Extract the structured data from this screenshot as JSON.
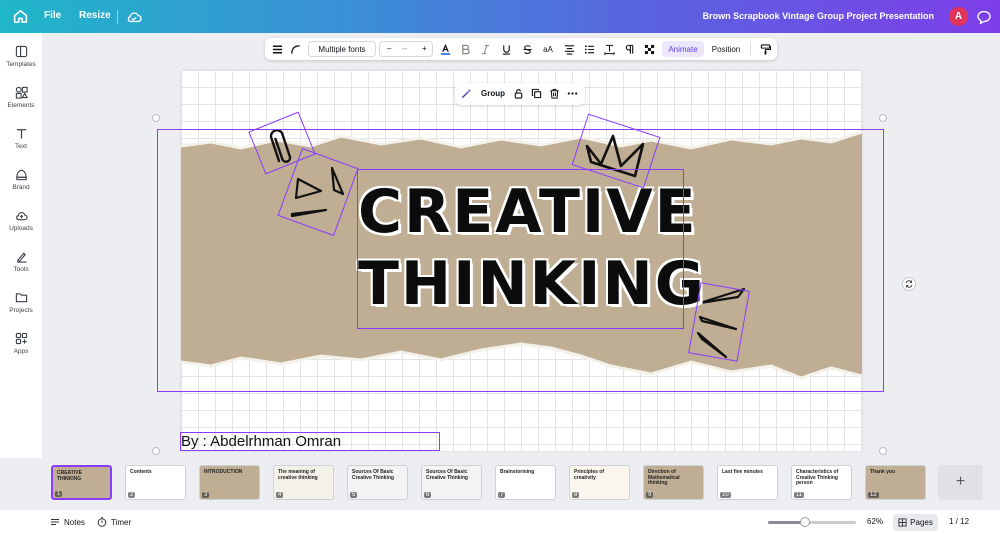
{
  "topbar": {
    "file_label": "File",
    "resize_label": "Resize",
    "document_title": "Brown Scrapbook Vintage Group Project Presentation",
    "avatar_initial": "A",
    "colors": {
      "gradient_start": "#1fb6c9",
      "gradient_end": "#7d3ee8",
      "avatar": "#e0345b"
    }
  },
  "sidebar": {
    "items": [
      {
        "label": "Templates",
        "icon": "templates-icon"
      },
      {
        "label": "Elements",
        "icon": "elements-icon"
      },
      {
        "label": "Text",
        "icon": "text-icon"
      },
      {
        "label": "Brand",
        "icon": "brand-icon"
      },
      {
        "label": "Uploads",
        "icon": "uploads-icon"
      },
      {
        "label": "Tools",
        "icon": "tools-icon"
      },
      {
        "label": "Projects",
        "icon": "projects-icon"
      },
      {
        "label": "Apps",
        "icon": "apps-icon"
      }
    ]
  },
  "toolbar": {
    "font_label": "Multiple fonts",
    "size_minus": "–",
    "size_value": "--",
    "size_plus": "+",
    "case_label": "aA",
    "animate_label": "Animate",
    "position_label": "Position",
    "accent": "#8b3dff"
  },
  "context_bar": {
    "group_label": "Group"
  },
  "slide": {
    "headline_line1": "CREATIVE",
    "headline_line2": "THINKING",
    "byline": "By : Abdelrhman Omran",
    "paper_color": "#bfae94"
  },
  "filmstrip": {
    "thumbnails": [
      {
        "num": "1",
        "title": "CREATIVE THINKING",
        "bg": "#bfae94"
      },
      {
        "num": "2",
        "title": "Contents",
        "bg": "#ffffff"
      },
      {
        "num": "3",
        "title": "INTRODUCTION",
        "bg": "#bfae94"
      },
      {
        "num": "4",
        "title": "The meaning of creative thinking",
        "bg": "#f4f1e8"
      },
      {
        "num": "5",
        "title": "Sources Of Basic Creative Thinking",
        "bg": "#f3f3f3"
      },
      {
        "num": "6",
        "title": "Sources Of Basic Creative Thinking",
        "bg": "#f3f3f3"
      },
      {
        "num": "7",
        "title": "Brainstorming",
        "bg": "#ffffff"
      },
      {
        "num": "8",
        "title": "Principles of creativity",
        "bg": "#faf6ee"
      },
      {
        "num": "9",
        "title": "Direction of Mathematical thinking",
        "bg": "#bfae94"
      },
      {
        "num": "10",
        "title": "Last five minutes",
        "bg": "#ffffff"
      },
      {
        "num": "11",
        "title": "Characteristics of Creative Thinking person",
        "bg": "#ffffff"
      },
      {
        "num": "12",
        "title": "Thank you",
        "bg": "#bfae94"
      }
    ],
    "add_label": "+"
  },
  "bottombar": {
    "notes_label": "Notes",
    "timer_label": "Timer",
    "zoom_label": "62%",
    "zoom_fraction": 0.42,
    "pages_label": "Pages",
    "page_counter": "1 / 12"
  }
}
